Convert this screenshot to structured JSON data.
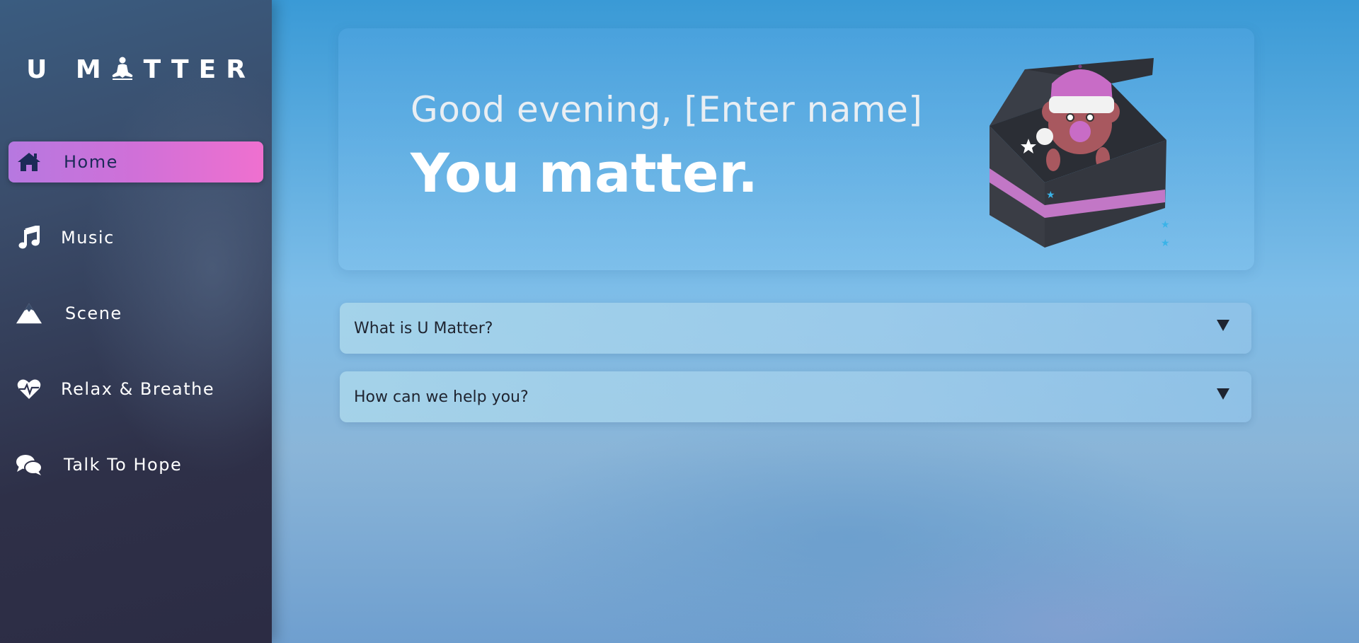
{
  "sidebar": {
    "logo_prefix": "U M",
    "logo_suffix": "TTER",
    "items": [
      {
        "label": "Home",
        "icon": "home-icon",
        "active": true
      },
      {
        "label": "Music",
        "icon": "music-note-icon",
        "active": false
      },
      {
        "label": "Scene",
        "icon": "mountain-icon",
        "active": false
      },
      {
        "label": "Relax & Breathe",
        "icon": "heartbeat-icon",
        "active": false
      },
      {
        "label": "Talk To Hope",
        "icon": "chat-bubbles-icon",
        "active": false
      }
    ]
  },
  "hero": {
    "greeting": "Good evening, [Enter name]",
    "tagline": "You matter.",
    "illustration": "bear-in-treasure-box"
  },
  "faq": [
    {
      "question": "What is U Matter?",
      "icon": "triangle-down-icon"
    },
    {
      "question": "How can we help you?",
      "icon": "triangle-down-icon"
    }
  ],
  "colors": {
    "accent_gradient_start": "#b678e0",
    "accent_gradient_end": "#ef70cf",
    "sidebar_top": "#3a5c80",
    "sidebar_bottom": "#2c2c44",
    "active_text": "#1c2a58"
  }
}
